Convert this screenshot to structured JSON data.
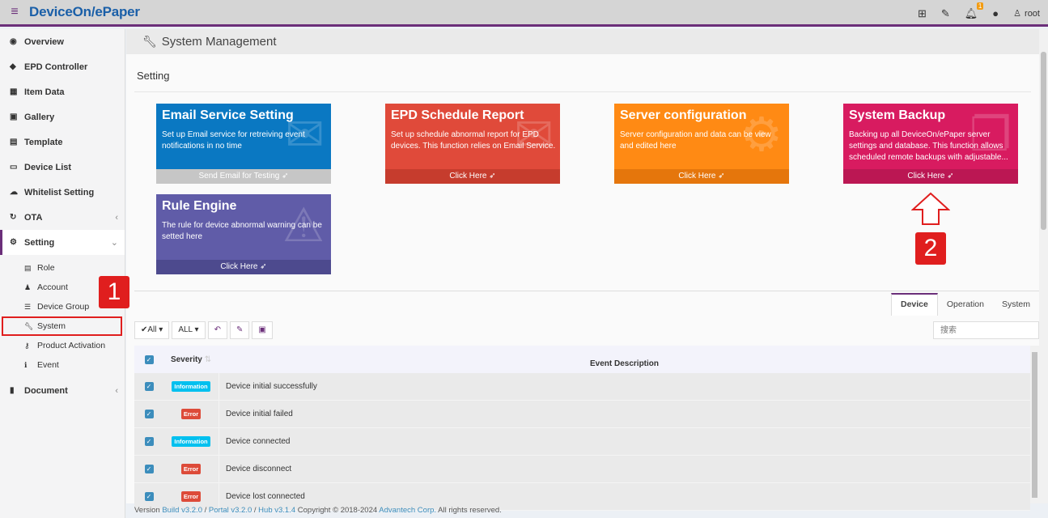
{
  "app": {
    "brand": "DeviceOn/ePaper",
    "user": "root",
    "bell_count": "1"
  },
  "sidebar": {
    "items": [
      {
        "label": "Overview",
        "icon": "dashboard-icon"
      },
      {
        "label": "EPD Controller",
        "icon": "tag-icon"
      },
      {
        "label": "Item Data",
        "icon": "table-icon"
      },
      {
        "label": "Gallery",
        "icon": "image-icon"
      },
      {
        "label": "Template",
        "icon": "id-card-icon"
      },
      {
        "label": "Device List",
        "icon": "monitor-icon"
      },
      {
        "label": "Whitelist Setting",
        "icon": "cloud-upload-icon"
      },
      {
        "label": "OTA",
        "icon": "refresh-icon"
      },
      {
        "label": "Setting",
        "icon": "gears-icon"
      }
    ],
    "sub_items": [
      {
        "label": "Role"
      },
      {
        "label": "Account"
      },
      {
        "label": "Device Group"
      },
      {
        "label": "System"
      },
      {
        "label": "Product Activation"
      },
      {
        "label": "Event"
      }
    ],
    "document": "Document"
  },
  "page": {
    "title": "System Management",
    "section": "Setting"
  },
  "cards": {
    "email": {
      "title": "Email Service Setting",
      "desc": "Set up Email service for retreiving event notifications in no time",
      "footer": "Send Email for Testing"
    },
    "epd": {
      "title": "EPD Schedule Report",
      "desc": "Set up schedule abnormal report for EPD devices. This function relies on Email Service.",
      "footer": "Click Here"
    },
    "server": {
      "title": "Server configuration",
      "desc": "Server configuration and data can be view and edited here",
      "footer": "Click Here"
    },
    "backup": {
      "title": "System Backup",
      "desc": "Backing up all DeviceOn/ePaper server settings and database. This function allows scheduled remote backups with adjustable...",
      "footer": "Click Here"
    },
    "rule": {
      "title": "Rule Engine",
      "desc": "The rule for device abnormal warning can be setted here",
      "footer": "Click Here"
    }
  },
  "tabs": [
    "Device",
    "Operation",
    "System"
  ],
  "toolbar": {
    "filter1": "All",
    "filter2": "ALL",
    "search_placeholder": "搜索"
  },
  "table": {
    "headers": {
      "severity": "Severity",
      "description": "Event Description"
    },
    "rows": [
      {
        "severity": "Information",
        "level": "info",
        "desc": "Device initial successfully"
      },
      {
        "severity": "Error",
        "level": "error",
        "desc": "Device initial failed"
      },
      {
        "severity": "Information",
        "level": "info",
        "desc": "Device connected"
      },
      {
        "severity": "Error",
        "level": "error",
        "desc": "Device disconnect"
      },
      {
        "severity": "Error",
        "level": "error",
        "desc": "Device lost connected"
      }
    ]
  },
  "footer": {
    "version": "Version",
    "build": "Build v3.2.0",
    "portal": "Portal v3.2.0",
    "hub": "Hub v3.1.4",
    "copyright": "Copyright © 2018-2024",
    "company": "Advantech Corp.",
    "rights": "All rights reserved.",
    "sep": "/"
  },
  "markers": {
    "one": "1",
    "two": "2"
  },
  "colors": {
    "accent": "#6b2f7a",
    "brand": "#1a5fa8",
    "marker": "#e01e1e"
  }
}
